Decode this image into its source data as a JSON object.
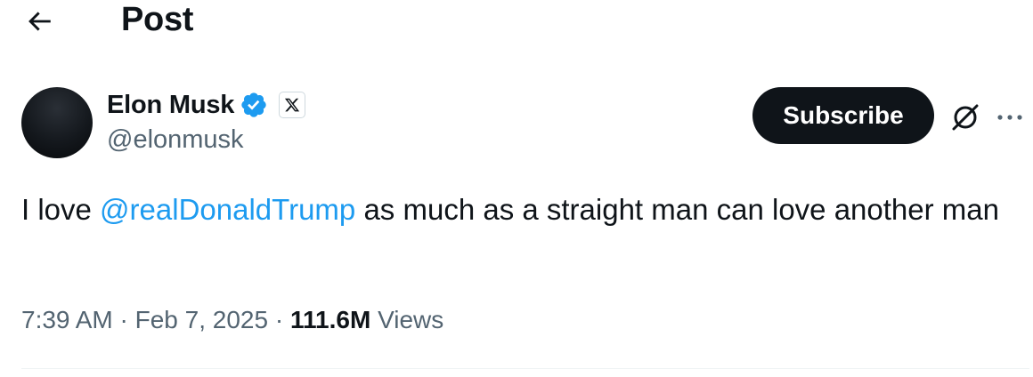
{
  "header": {
    "title": "Post",
    "back_icon": "arrow-left-icon"
  },
  "author": {
    "name": "Elon Musk",
    "handle": "@elonmusk",
    "verified_icon": "verified-badge-icon",
    "affiliate_icon": "x-logo-icon",
    "verified_color": "#1d9bf0"
  },
  "actions": {
    "subscribe_label": "Subscribe",
    "grok_icon": "grok-icon",
    "more_icon": "more-horizontal-icon"
  },
  "tweet": {
    "text_before": "I love ",
    "mention": "@realDonaldTrump",
    "text_after": " as much as a straight man can love another man"
  },
  "meta": {
    "time": "7:39 AM",
    "separator": "·",
    "date": "Feb 7, 2025",
    "views_count": "111.6M",
    "views_label": "Views"
  },
  "colors": {
    "text": "#0f1419",
    "secondary": "#536471",
    "link": "#1d9bf0",
    "button_bg": "#0f1419",
    "divider": "#eff3f4"
  }
}
